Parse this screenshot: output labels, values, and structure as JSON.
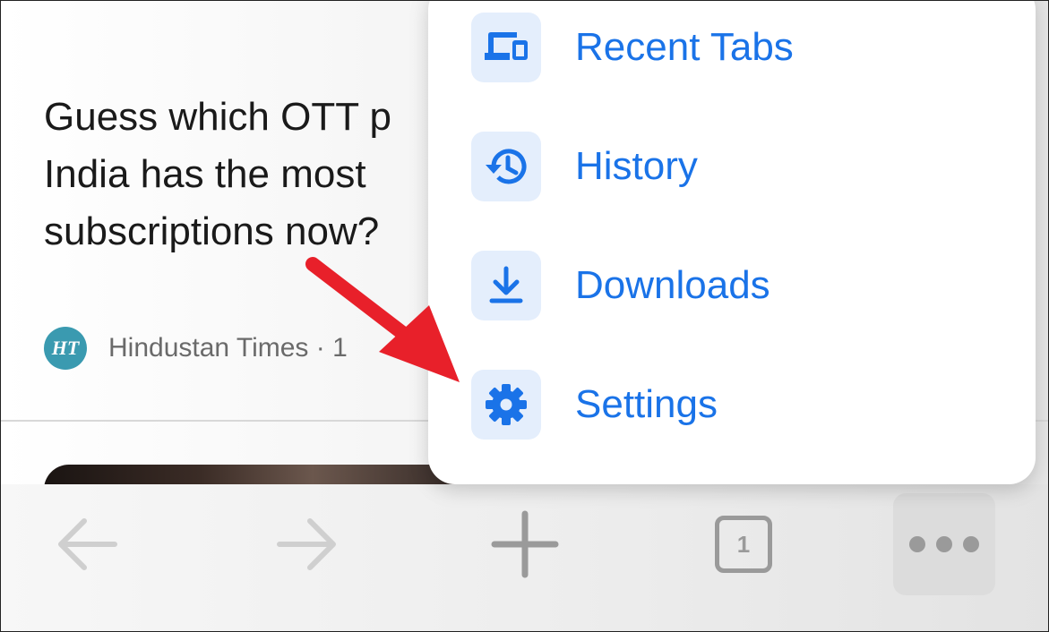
{
  "article": {
    "headline": "Guess which OTT p\nIndia has the most\nsubscriptions now?",
    "source_logo": "HT",
    "source": "Hindustan Times · 1"
  },
  "menu": {
    "items": [
      {
        "label": "Recent Tabs",
        "icon": "devices-icon"
      },
      {
        "label": "History",
        "icon": "history-icon"
      },
      {
        "label": "Downloads",
        "icon": "download-icon"
      },
      {
        "label": "Settings",
        "icon": "gear-icon"
      }
    ],
    "label_color": "#1a73e8",
    "icon_bg_color": "#e4eefc"
  },
  "toolbar": {
    "tab_count": "1",
    "buttons": [
      "back-arrow-icon",
      "forward-arrow-icon",
      "plus-icon",
      "tab-switcher-icon",
      "more-icon"
    ],
    "icon_color": "#9a9a9a"
  },
  "annotation": {
    "arrow_color": "#e8202a",
    "points_to": "Settings"
  }
}
